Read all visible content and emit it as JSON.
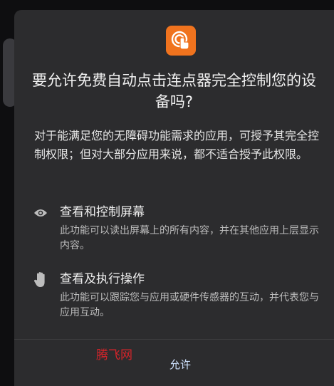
{
  "dialog": {
    "title": "要允许免费自动点击连点器完全控制您的设备吗?",
    "description": "对于能满足您的无障碍功能需求的应用，可授予其完全控制权限；但对大部分应用来说，都不适合授予此权限。",
    "permissions": [
      {
        "icon": "eye-icon",
        "title": "查看和控制屏幕",
        "description": "此功能可以读出屏幕上的所有内容，并在其他应用上层显示内容。"
      },
      {
        "icon": "hand-icon",
        "title": "查看及执行操作",
        "description": "此功能可以跟踪您与应用或硬件传感器的互动，并代表您与应用互动。"
      }
    ],
    "allow_label": "允许",
    "app_icon": "auto-clicker-app-icon",
    "accent_color": "#f0731e"
  },
  "watermark": "腾飞网"
}
